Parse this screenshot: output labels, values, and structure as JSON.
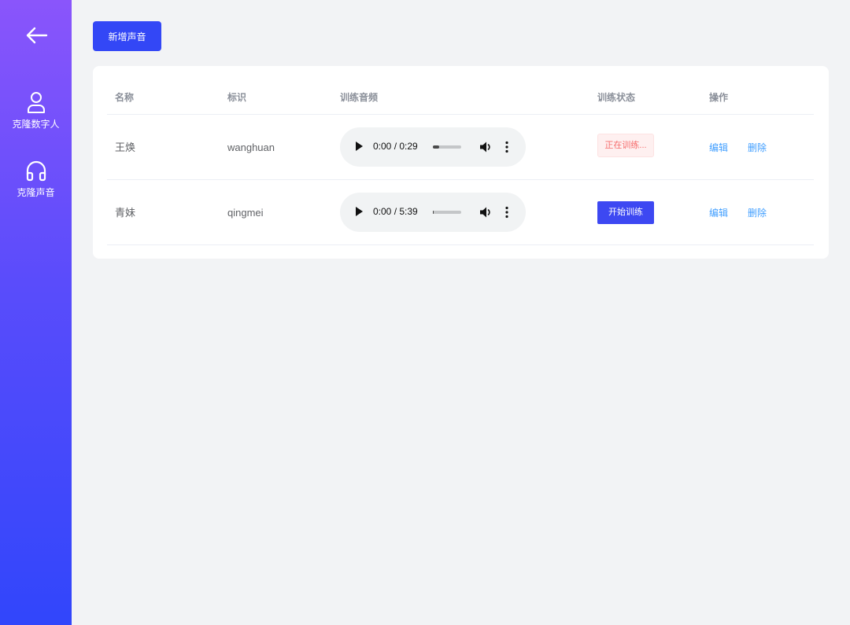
{
  "colors": {
    "sidebar_top": "#8a55fb",
    "sidebar_bottom": "#3146fb",
    "primary_button": "#3347f6",
    "link": "#409eff",
    "status_training_text": "#f56c6c",
    "status_training_bg": "#fef0f0",
    "page_bg": "#f2f3f5"
  },
  "sidebar": {
    "back_icon": "arrow-left-icon",
    "items": [
      {
        "label": "克隆数字人",
        "icon": "user-icon"
      },
      {
        "label": "克隆声音",
        "icon": "headphones-icon"
      }
    ]
  },
  "toolbar": {
    "add_voice_label": "新增声音"
  },
  "table": {
    "columns": [
      "名称",
      "标识",
      "训练音频",
      "训练状态",
      "操作"
    ],
    "rows": [
      {
        "name": "王焕",
        "id": "wanghuan",
        "audio_time": "0:00 / 0:29",
        "audio_progress": 0.22,
        "status": "正在训练...",
        "status_type": "training",
        "edit_label": "编辑",
        "delete_label": "删除"
      },
      {
        "name": "青妹",
        "id": "qingmei",
        "audio_time": "0:00 / 5:39",
        "audio_progress": 0.03,
        "status": "开始训练",
        "status_type": "start_button",
        "edit_label": "编辑",
        "delete_label": "删除"
      }
    ]
  }
}
